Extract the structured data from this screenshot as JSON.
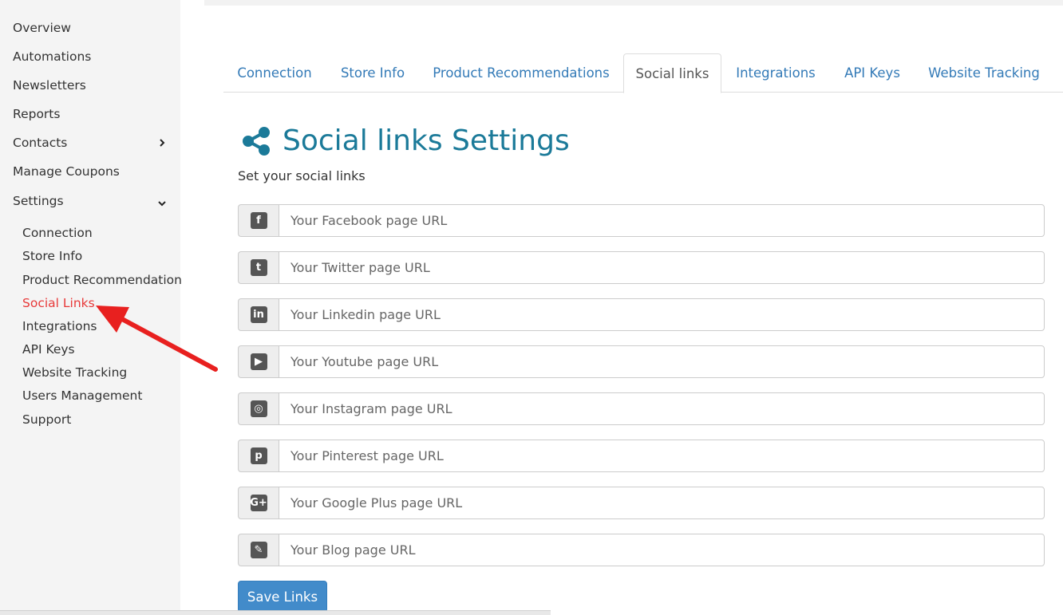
{
  "sidebar": {
    "items": [
      {
        "label": "Overview"
      },
      {
        "label": "Automations"
      },
      {
        "label": "Newsletters"
      },
      {
        "label": "Reports"
      },
      {
        "label": "Contacts",
        "chevron": "›"
      },
      {
        "label": "Manage Coupons"
      },
      {
        "label": "Settings",
        "chevron": "⌄"
      }
    ],
    "sub_items": [
      {
        "label": "Connection"
      },
      {
        "label": "Store Info"
      },
      {
        "label": "Product Recommendation"
      },
      {
        "label": "Social Links",
        "active": true
      },
      {
        "label": "Integrations"
      },
      {
        "label": "API Keys"
      },
      {
        "label": "Website Tracking"
      },
      {
        "label": "Users Management"
      },
      {
        "label": "Support"
      }
    ]
  },
  "tabs": [
    {
      "label": "Connection"
    },
    {
      "label": "Store Info"
    },
    {
      "label": "Product Recommendations"
    },
    {
      "label": "Social links",
      "active": true
    },
    {
      "label": "Integrations"
    },
    {
      "label": "API Keys"
    },
    {
      "label": "Website Tracking"
    }
  ],
  "header": {
    "title": "Social links Settings",
    "icon": "share-icon",
    "subtitle": "Set your social links"
  },
  "fields": [
    {
      "icon": "facebook-icon",
      "glyph": "f",
      "placeholder": "Your Facebook page URL",
      "value": ""
    },
    {
      "icon": "twitter-icon",
      "glyph": "t",
      "placeholder": "Your Twitter page URL",
      "value": ""
    },
    {
      "icon": "linkedin-icon",
      "glyph": "in",
      "placeholder": "Your Linkedin page URL",
      "value": ""
    },
    {
      "icon": "youtube-icon",
      "glyph": "▶",
      "placeholder": "Your Youtube page URL",
      "value": ""
    },
    {
      "icon": "instagram-icon",
      "glyph": "◎",
      "placeholder": "Your Instagram page URL",
      "value": ""
    },
    {
      "icon": "pinterest-icon",
      "glyph": "p",
      "placeholder": "Your Pinterest page URL",
      "value": ""
    },
    {
      "icon": "google-plus-icon",
      "glyph": "G+",
      "placeholder": "Your Google Plus page URL",
      "value": ""
    },
    {
      "icon": "pencil-icon",
      "glyph": "✎",
      "placeholder": "Your Blog page URL",
      "value": ""
    }
  ],
  "save_button": {
    "label": "Save Links"
  },
  "colors": {
    "accent": "#1b7a99",
    "link": "#337ab7",
    "active_sidebar": "#e83a3a",
    "button": "#428bca",
    "annotation_arrow": "#e8201f"
  }
}
